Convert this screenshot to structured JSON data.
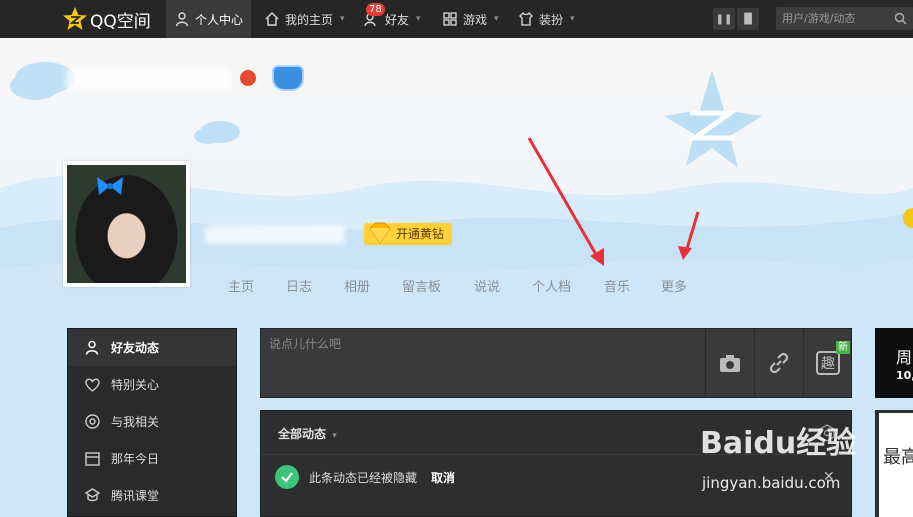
{
  "topbar": {
    "logo_text": "QQ空间",
    "nav": [
      {
        "label": "个人中心",
        "icon": "person-icon",
        "active": true
      },
      {
        "label": "我的主页",
        "icon": "home-icon"
      },
      {
        "label": "好友",
        "icon": "friends-icon",
        "badge": "78"
      },
      {
        "label": "游戏",
        "icon": "grid-icon"
      },
      {
        "label": "装扮",
        "icon": "shirt-icon"
      }
    ],
    "search_placeholder": "用户/游戏/动态"
  },
  "profile": {
    "vip_button": "开通黄钻",
    "tabs": [
      "主页",
      "日志",
      "相册",
      "留言板",
      "说说",
      "个人档",
      "音乐",
      "更多"
    ]
  },
  "sidebar": {
    "items": [
      {
        "label": "好友动态",
        "icon": "person-icon",
        "active": true
      },
      {
        "label": "特别关心",
        "icon": "heart-icon"
      },
      {
        "label": "与我相关",
        "icon": "at-icon"
      },
      {
        "label": "那年今日",
        "icon": "calendar-icon"
      },
      {
        "label": "腾讯课堂",
        "icon": "class-icon"
      }
    ]
  },
  "status": {
    "placeholder": "说点儿什么吧",
    "new_tag": "新",
    "qu_label": "趣"
  },
  "feed": {
    "title": "全部动态",
    "notice": "此条动态已经被隐藏",
    "cancel": "取消"
  },
  "right": {
    "day": "周",
    "date": "10,",
    "card_text": "最高"
  },
  "watermark": {
    "brand": "Baidu经验",
    "url": "jingyan.baidu.com"
  },
  "colors": {
    "topbar_bg": "#262626",
    "vip_yellow": "#ffd23a",
    "arrow_red": "#e8303a",
    "check_green": "#3ec47a"
  }
}
